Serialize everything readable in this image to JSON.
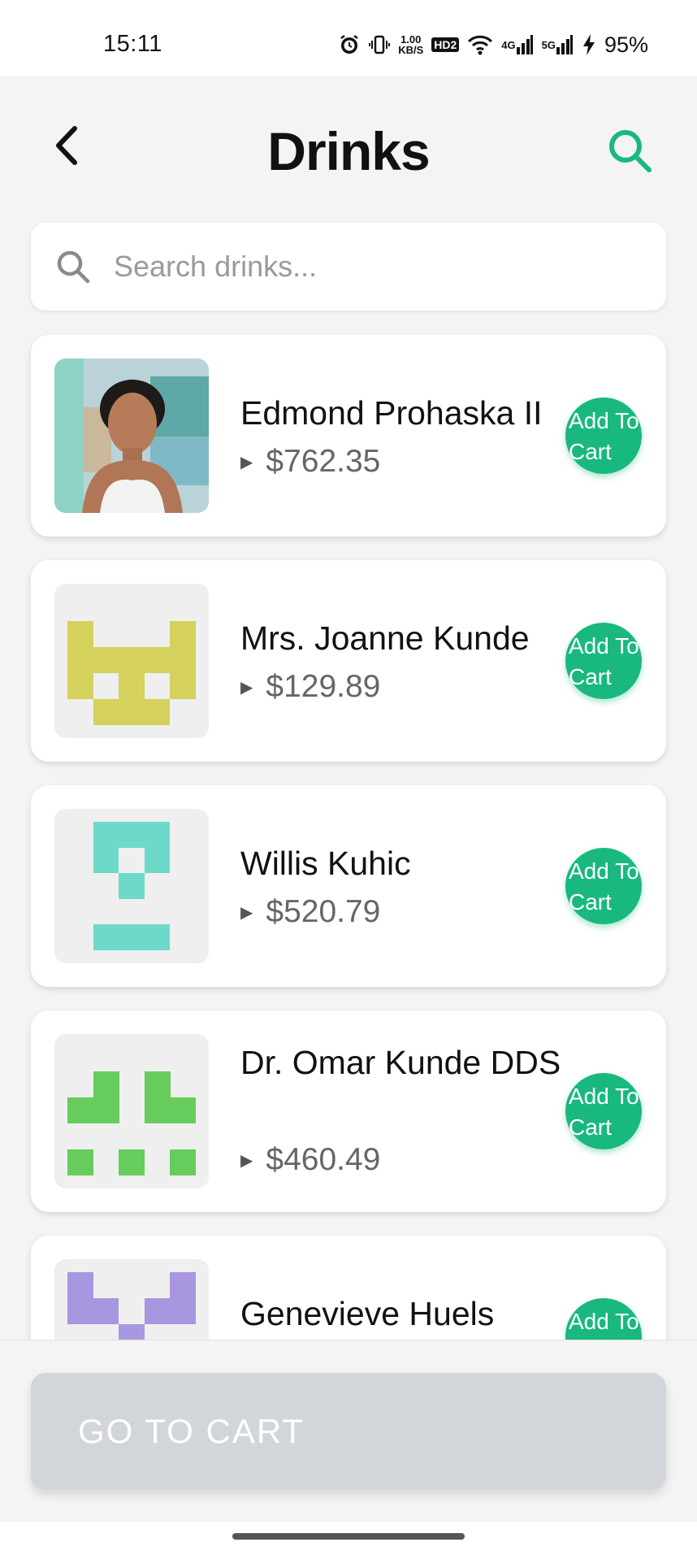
{
  "status_bar": {
    "time": "15:11",
    "net_speed_value": "1.00",
    "net_speed_unit": "KB/S",
    "hd_label": "HD2",
    "signal_1_label": "4G",
    "signal_2_label": "5G",
    "battery": "95%"
  },
  "header": {
    "title": "Drinks",
    "back_icon": "chevron-left-icon",
    "search_icon": "search-icon"
  },
  "search": {
    "placeholder": "Search drinks..."
  },
  "items": [
    {
      "name": "Edmond Prohaska II",
      "price": "$762.35",
      "add_label": "Add To Cart"
    },
    {
      "name": "Mrs. Joanne Kunde",
      "price": "$129.89",
      "add_label": "Add To Cart"
    },
    {
      "name": "Willis Kuhic",
      "price": "$520.79",
      "add_label": "Add To Cart"
    },
    {
      "name": "Dr. Omar Kunde DDS",
      "price": "$460.49",
      "add_label": "Add To Cart"
    },
    {
      "name": "Genevieve Huels",
      "price": "",
      "add_label": "Add To Cart"
    }
  ],
  "cart_button": {
    "label": "GO TO CART"
  },
  "colors": {
    "accent": "#19b87e",
    "identicon_yellow": "#d4d15d",
    "identicon_teal": "#6dd9c9",
    "identicon_green": "#66cc5c",
    "identicon_purple": "#a897e0"
  }
}
